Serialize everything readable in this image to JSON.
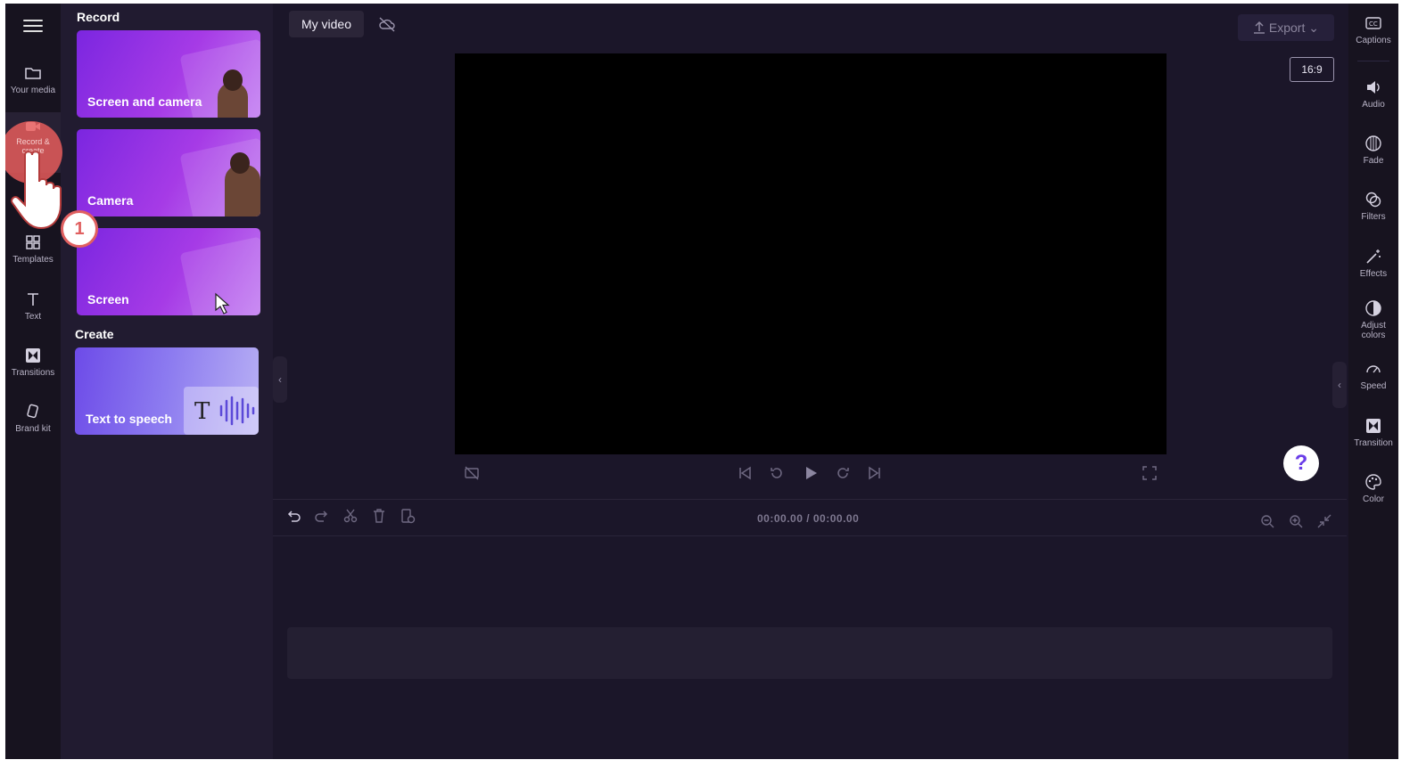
{
  "project": {
    "title": "My video"
  },
  "left_rail": {
    "items": [
      {
        "label": "Your media",
        "icon": "folder-icon"
      },
      {
        "label": "Record & create",
        "icon": "camera-icon"
      },
      {
        "label": "Templates",
        "icon": "templates-icon"
      },
      {
        "label": "Text",
        "icon": "text-icon"
      },
      {
        "label": "Transitions",
        "icon": "transitions-icon"
      },
      {
        "label": "Brand kit",
        "icon": "brand-kit-icon"
      }
    ]
  },
  "panel": {
    "record_heading": "Record",
    "create_heading": "Create",
    "cards": [
      {
        "label": "Screen and camera"
      },
      {
        "label": "Camera"
      },
      {
        "label": "Screen"
      }
    ],
    "create_cards": [
      {
        "label": "Text to speech"
      }
    ]
  },
  "toolbar": {
    "export_label": "Export",
    "aspect_ratio": "16:9"
  },
  "timeline": {
    "timecode": "00:00.00 / 00:00.00"
  },
  "help": {
    "label": "?"
  },
  "right_rail": {
    "items": [
      {
        "label": "Captions",
        "icon": "captions-icon"
      },
      {
        "label": "Audio",
        "icon": "audio-icon"
      },
      {
        "label": "Fade",
        "icon": "fade-icon"
      },
      {
        "label": "Filters",
        "icon": "filters-icon"
      },
      {
        "label": "Effects",
        "icon": "effects-icon"
      },
      {
        "label": "Adjust colors",
        "icon": "adjust-colors-icon"
      },
      {
        "label": "Speed",
        "icon": "speed-icon"
      },
      {
        "label": "Transition",
        "icon": "transition-icon"
      },
      {
        "label": "Color",
        "icon": "color-icon"
      }
    ]
  },
  "tutorial": {
    "step": "1"
  },
  "colors": {
    "accent": "#7b26e0",
    "background": "#1b1629",
    "highlight": "#e06060"
  }
}
